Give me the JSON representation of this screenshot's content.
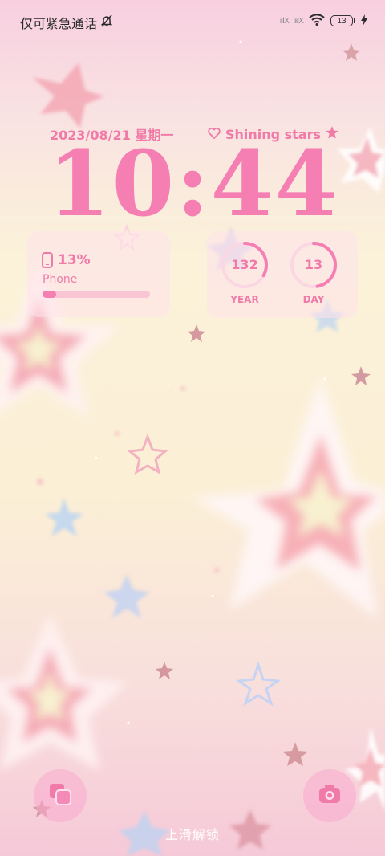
{
  "status_bar": {
    "carrier_text": "仅可紧急通话",
    "signal_1": "ıılX",
    "signal_2": "ıılX",
    "battery_level": "13"
  },
  "lock_screen": {
    "date": "2023/08/21 星期一",
    "tagline": "Shining stars",
    "time": "10:44"
  },
  "widgets": {
    "phone": {
      "percent_text": "13%",
      "label": "Phone",
      "percent": 13
    },
    "year": {
      "value": "132",
      "label": "YEAR"
    },
    "day": {
      "value": "13",
      "label": "DAY"
    }
  },
  "bottom": {
    "unlock_hint": "上滑解锁"
  },
  "colors": {
    "accent_pink": "#f57fb3",
    "text_pink": "#f07aa8"
  },
  "icons": [
    "mute-bell-icon",
    "signal-icon",
    "wifi-icon",
    "battery-icon",
    "charging-icon",
    "heart-icon",
    "star-icon",
    "phone-icon",
    "multitask-icon",
    "camera-icon"
  ]
}
